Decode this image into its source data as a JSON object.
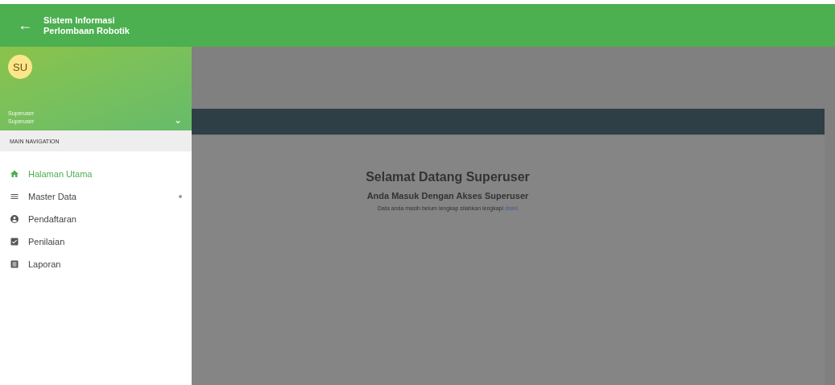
{
  "app_bar": {
    "back": "←",
    "title_lines": [
      "Sistem Informasi",
      "Perlombaan Robotik"
    ]
  },
  "profile": {
    "initials": "SU",
    "name": "Superuser",
    "role": "Superuser",
    "dropdown": "⌄"
  },
  "sidebar": {
    "header": "MAIN NAVIGATION",
    "items": [
      {
        "label": "Halaman Utama",
        "kind": "home",
        "selected": true,
        "expandable": false
      },
      {
        "label": "Master Data",
        "kind": "list",
        "selected": false,
        "expandable": true
      },
      {
        "label": "Pendaftaran",
        "kind": "account",
        "selected": false,
        "expandable": false
      },
      {
        "label": "Penilaian",
        "kind": "check",
        "selected": false,
        "expandable": false
      },
      {
        "label": "Laporan",
        "kind": "report",
        "selected": false,
        "expandable": false
      }
    ]
  },
  "main": {
    "title": "Selamat Datang Superuser",
    "subtitle": "Anda Masuk Dengan Akses Superuser",
    "notice": "Data anda masih belum lengkap silahkan lengkapi",
    "notice_link": "disini"
  }
}
